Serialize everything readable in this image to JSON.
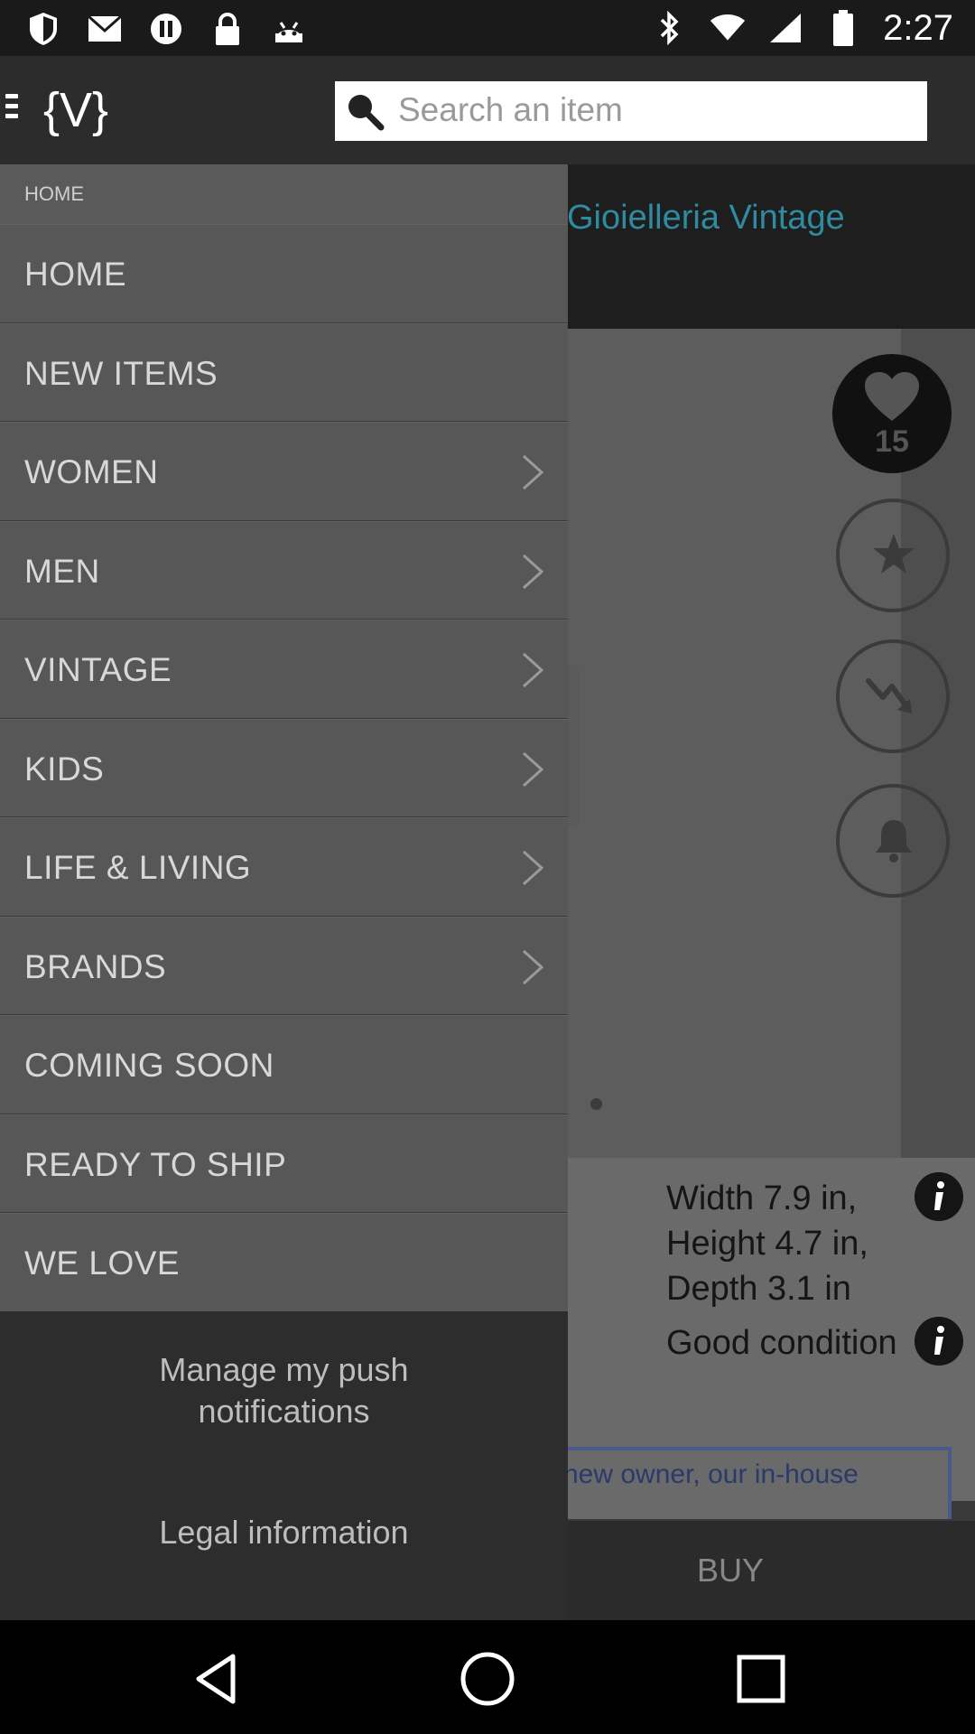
{
  "status_bar": {
    "time": "2:27",
    "left_icons": [
      "shield-icon",
      "mail-icon",
      "dnd-icon",
      "lock-icon",
      "android-icon"
    ],
    "right_icons": [
      "bluetooth-icon",
      "wifi-icon",
      "signal-icon",
      "battery-icon"
    ]
  },
  "app_bar": {
    "logo": "{V}",
    "search": {
      "placeholder": "Search an item",
      "value": ""
    }
  },
  "content": {
    "shop_title": "Gioielleria Vintage",
    "favorites_count": "15",
    "details": [
      "Width 7.9 in, Height 4.7 in, Depth 3.1 in",
      "Good condition"
    ],
    "note": "new owner, our in-house",
    "buy_label": "BUY"
  },
  "drawer": {
    "header": "HOME",
    "items": [
      {
        "label": "HOME",
        "has_submenu": false
      },
      {
        "label": "NEW ITEMS",
        "has_submenu": false
      },
      {
        "label": "WOMEN",
        "has_submenu": true
      },
      {
        "label": "MEN",
        "has_submenu": true
      },
      {
        "label": "VINTAGE",
        "has_submenu": true
      },
      {
        "label": "KIDS",
        "has_submenu": true
      },
      {
        "label": "LIFE & LIVING",
        "has_submenu": true
      },
      {
        "label": "BRANDS",
        "has_submenu": true
      },
      {
        "label": "COMING SOON",
        "has_submenu": false
      },
      {
        "label": "READY TO SHIP",
        "has_submenu": false
      },
      {
        "label": "WE LOVE",
        "has_submenu": false
      }
    ],
    "footer": {
      "push_notifications": "Manage my push notifications",
      "legal": "Legal information"
    }
  },
  "nav_bar": {
    "buttons": [
      "back-icon",
      "home-icon",
      "recents-icon"
    ]
  }
}
